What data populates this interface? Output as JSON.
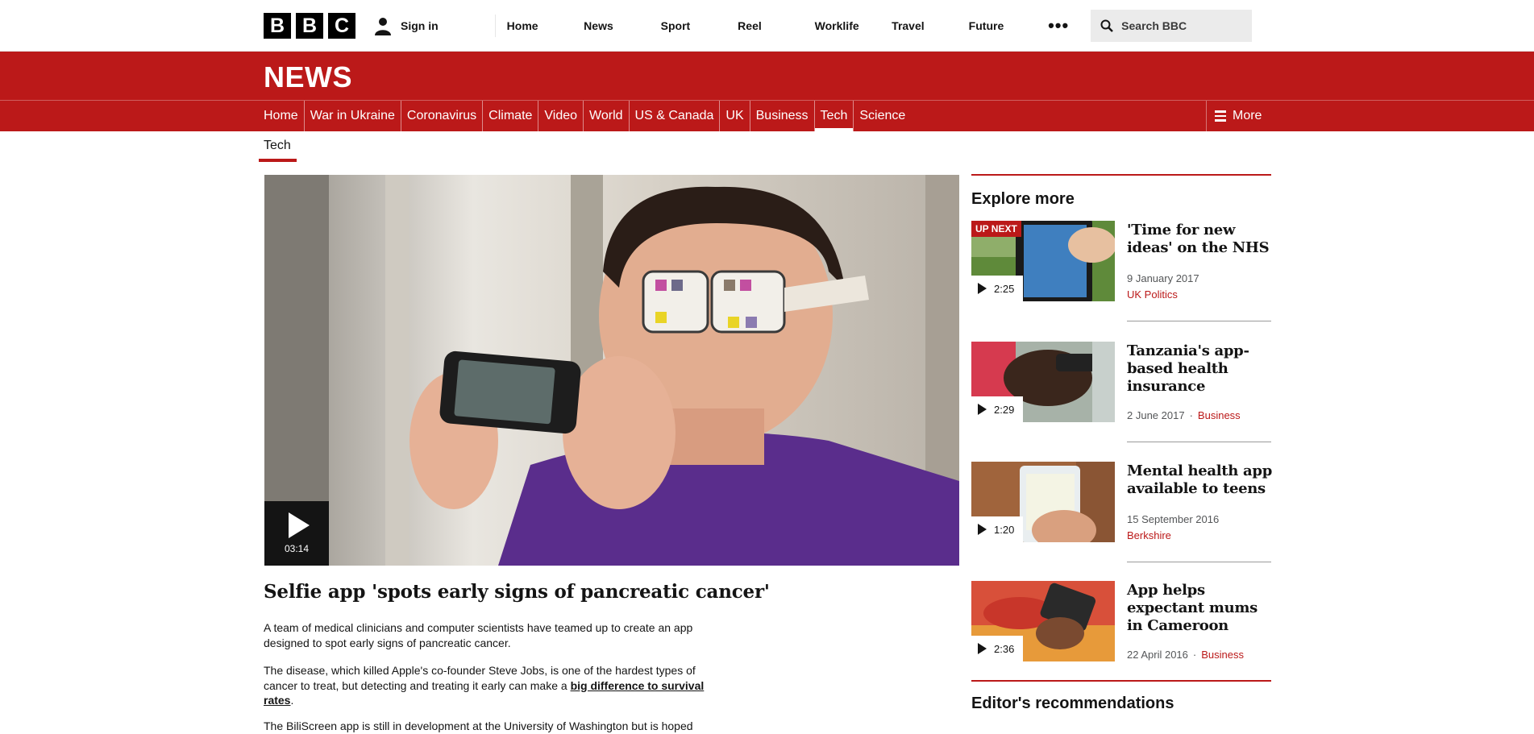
{
  "topbar": {
    "logo_letters": [
      "B",
      "B",
      "C"
    ],
    "signin_label": "Sign in",
    "nav": [
      "Home",
      "News",
      "Sport",
      "Reel",
      "Worklife",
      "Travel",
      "Future"
    ],
    "more_label": "•••",
    "search_placeholder": "Search BBC"
  },
  "news": {
    "title": "NEWS",
    "nav": [
      "Home",
      "War in Ukraine",
      "Coronavirus",
      "Climate",
      "Video",
      "World",
      "US & Canada",
      "UK",
      "Business",
      "Tech",
      "Science"
    ],
    "active_nav": "Tech",
    "more_label": "More"
  },
  "section": {
    "tab": "Tech"
  },
  "video": {
    "duration": "03:14"
  },
  "article": {
    "headline": "Selfie app 'spots early signs of pancreatic cancer'",
    "para1": "A team of medical clinicians and computer scientists have teamed up to create an app designed to spot early signs of pancreatic cancer.",
    "para2_before": "The disease, which killed Apple's co-founder Steve Jobs, is one of the hardest types of cancer to treat, but detecting and treating it early can make a ",
    "para2_link": "big difference to survival rates",
    "para2_after": ".",
    "para3": "The BiliScreen app is still in development at the University of Washington but is hoped"
  },
  "sidebar": {
    "heading": "Explore more",
    "up_next_label": "UP NEXT",
    "items": [
      {
        "title": "'Time for new ideas' on the NHS",
        "duration": "2:25",
        "date": "9 January 2017",
        "category": "UK Politics"
      },
      {
        "title": "Tanzania's app-based health insurance",
        "duration": "2:29",
        "date": "2 June 2017",
        "category": "Business"
      },
      {
        "title": "Mental health app available to teens",
        "duration": "1:20",
        "date": "15 September 2016",
        "category": "Berkshire"
      },
      {
        "title": "App helps expectant mums in Cameroon",
        "duration": "2:36",
        "date": "22 April 2016",
        "category": "Business"
      }
    ],
    "editors_heading": "Editor's recommendations"
  },
  "colors": {
    "brand_red": "#bb1919",
    "text": "#141414",
    "meta": "#545658"
  }
}
